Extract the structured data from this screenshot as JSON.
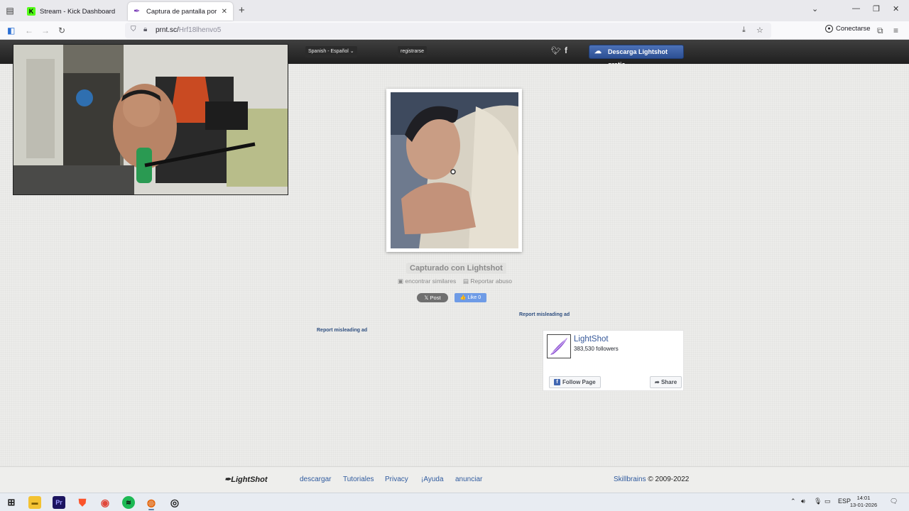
{
  "browser": {
    "tabs": [
      {
        "title": "Stream - Kick Dashboard",
        "favicon": "K"
      },
      {
        "title": "Captura de pantalla por Lightshot",
        "favicon": "✒"
      }
    ],
    "url": {
      "host": "prnt.sc/",
      "path": "Hrf18lhenvo5"
    },
    "signin_label": "Conectarse"
  },
  "lightshot": {
    "language": "Spanish - Español",
    "register": "registrarse",
    "download_button": "Descarga Lightshot gratis",
    "captured_label": "Capturado con Lightshot",
    "find_similar": "encontrar similares",
    "report_abuse": "Reportar abuso",
    "post_label": "𝕏 Post",
    "like_label": "👍 Like 0",
    "ad_link_right": "Report misleading ad",
    "ad_link_left": "Report misleading ad",
    "fb_widget": {
      "page_name": "LightShot",
      "followers": "383,530 followers",
      "follow_label": "Follow Page",
      "share_label": "Share"
    },
    "footer": {
      "logo": "LightShot",
      "links": [
        "descargar",
        "Tutoriales",
        "Privacy",
        "¡Ayuda",
        "anunciar"
      ],
      "company": "Skillbrains",
      "copyright": "© 2009-2022"
    }
  },
  "taskbar": {
    "language": "ESP",
    "time": "14:01",
    "date": "13-01-2026"
  }
}
